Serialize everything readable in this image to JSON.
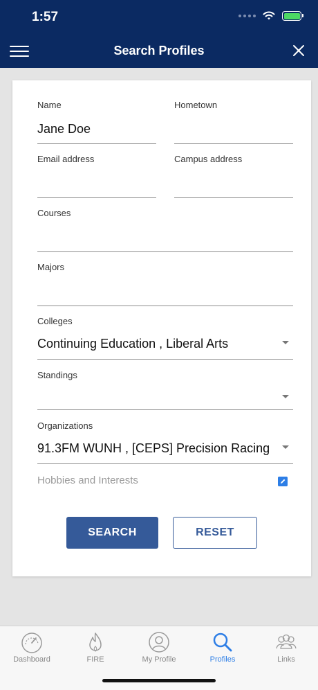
{
  "status_bar": {
    "time": "1:57"
  },
  "header": {
    "title": "Search Profiles"
  },
  "form": {
    "name": {
      "label": "Name",
      "value": "Jane Doe"
    },
    "hometown": {
      "label": "Hometown",
      "value": ""
    },
    "email": {
      "label": "Email address",
      "value": ""
    },
    "campus_address": {
      "label": "Campus address",
      "value": ""
    },
    "courses": {
      "label": "Courses",
      "value": ""
    },
    "majors": {
      "label": "Majors",
      "value": ""
    },
    "colleges": {
      "label": "Colleges",
      "value": "Continuing Education , Liberal Arts"
    },
    "standings": {
      "label": "Standings",
      "value": ""
    },
    "organizations": {
      "label": "Organizations",
      "value": "91.3FM WUNH , [CEPS] Precision Racing"
    },
    "hobbies": {
      "label": "Hobbies and Interests"
    }
  },
  "buttons": {
    "search": "SEARCH",
    "reset": "RESET"
  },
  "tabs": [
    {
      "label": "Dashboard",
      "icon": "speedometer-icon"
    },
    {
      "label": "FIRE",
      "icon": "flame-icon"
    },
    {
      "label": "My Profile",
      "icon": "profile-icon"
    },
    {
      "label": "Profiles",
      "icon": "search-icon",
      "active": true
    },
    {
      "label": "Links",
      "icon": "people-icon"
    }
  ],
  "colors": {
    "header": "#0b2a62",
    "accent": "#355a99",
    "active_tab": "#2d7ee6"
  }
}
